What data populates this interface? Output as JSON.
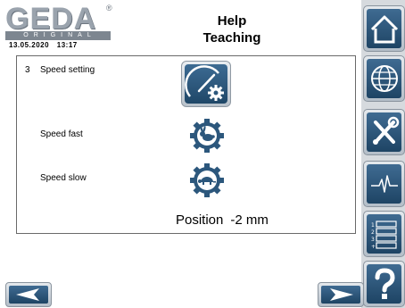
{
  "header": {
    "logo_text": "GEDA",
    "logo_sub": "ORIGINAL",
    "logo_mark": "®",
    "date": "13.05.2020",
    "time": "13:17",
    "title_line1": "Help",
    "title_line2": "Teaching"
  },
  "panel": {
    "step_number": "3",
    "speed_setting_label": "Speed setting",
    "speed_fast_label": "Speed fast",
    "speed_slow_label": "Speed slow",
    "position_label": "Position",
    "position_value": "-2 mm"
  },
  "sidebar": {
    "buttons": [
      {
        "icon": "home-icon"
      },
      {
        "icon": "globe-icon"
      },
      {
        "icon": "tools-icon"
      },
      {
        "icon": "pulse-icon"
      },
      {
        "icon": "list-icon",
        "list_numbers": [
          "1",
          "2",
          "3",
          "+"
        ]
      },
      {
        "icon": "help-icon"
      }
    ]
  },
  "nav": {
    "prev_icon": "arrow-left-icon",
    "next_icon": "arrow-right-icon"
  },
  "colors": {
    "button_blue": "#2c577c",
    "frame_gray": "#b4bec8",
    "logo_gray": "#9aa3ad"
  }
}
